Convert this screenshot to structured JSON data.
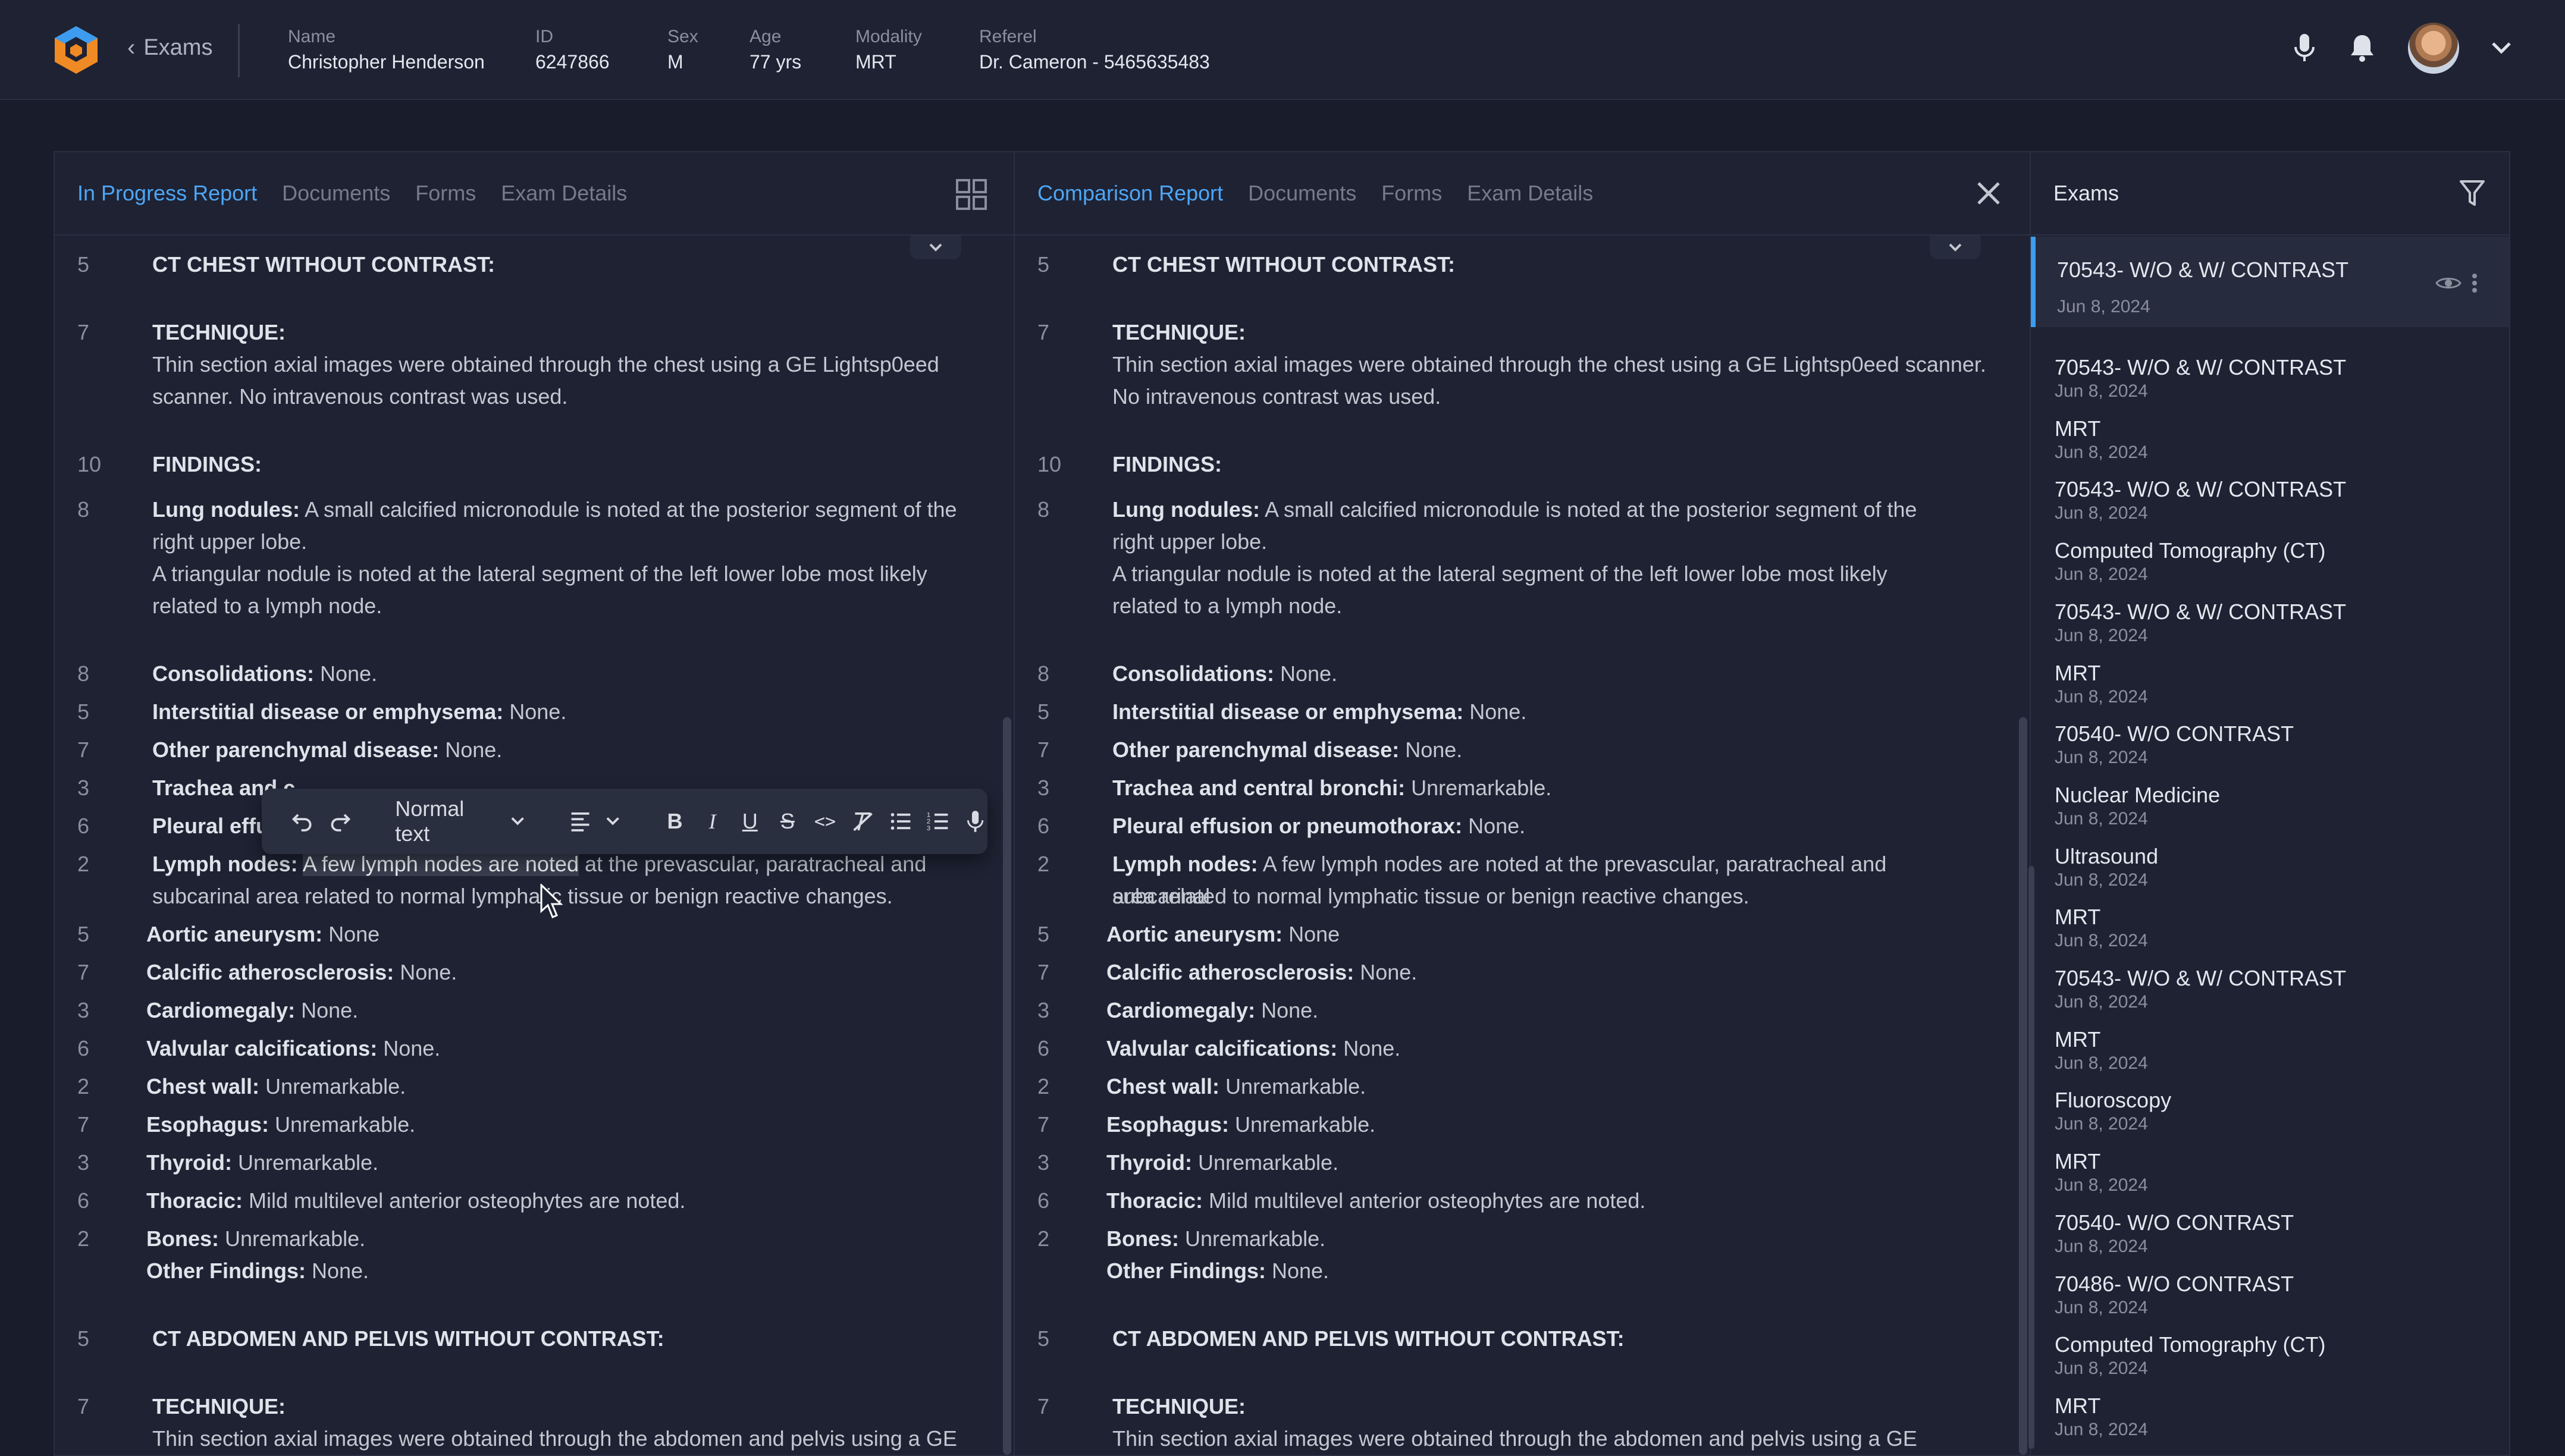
{
  "header": {
    "back_label": "Exams",
    "patient": [
      {
        "label": "Name",
        "value": "Christopher Henderson"
      },
      {
        "label": "ID",
        "value": "6247866"
      },
      {
        "label": "Sex",
        "value": "M"
      },
      {
        "label": "Age",
        "value": "77 yrs"
      },
      {
        "label": "Modality",
        "value": "MRT"
      },
      {
        "label": "Referel",
        "value": "Dr. Cameron - 5465635483"
      }
    ]
  },
  "left_panel": {
    "tabs": [
      "In Progress Report",
      "Documents",
      "Forms",
      "Exam Details"
    ]
  },
  "compare_panel": {
    "tabs": [
      "Comparison Report",
      "Documents",
      "Forms",
      "Exam Details"
    ]
  },
  "exams_panel": {
    "title": "Exams",
    "items": [
      {
        "name": "70543- W/O & W/ CONTRAST",
        "date": "Jun 8, 2024"
      },
      {
        "name": "70543- W/O & W/ CONTRAST",
        "date": "Jun 8, 2024"
      },
      {
        "name": "MRT",
        "date": "Jun 8, 2024"
      },
      {
        "name": "70543- W/O & W/ CONTRAST",
        "date": "Jun 8, 2024"
      },
      {
        "name": "Computed Tomography (CT)",
        "date": "Jun 8, 2024"
      },
      {
        "name": "70543- W/O & W/ CONTRAST",
        "date": "Jun 8, 2024"
      },
      {
        "name": "MRT",
        "date": "Jun 8, 2024"
      },
      {
        "name": "70540- W/O CONTRAST",
        "date": "Jun 8, 2024"
      },
      {
        "name": "Nuclear Medicine",
        "date": "Jun 8, 2024"
      },
      {
        "name": "Ultrasound",
        "date": "Jun 8, 2024"
      },
      {
        "name": "MRT",
        "date": "Jun 8, 2024"
      },
      {
        "name": "70543- W/O & W/ CONTRAST",
        "date": "Jun 8, 2024"
      },
      {
        "name": "MRT",
        "date": "Jun 8, 2024"
      },
      {
        "name": "Fluoroscopy",
        "date": "Jun 8, 2024"
      },
      {
        "name": "MRT",
        "date": "Jun 8, 2024"
      },
      {
        "name": "70540- W/O CONTRAST",
        "date": "Jun 8, 2024"
      },
      {
        "name": "70486- W/O CONTRAST",
        "date": "Jun 8, 2024"
      },
      {
        "name": "Computed Tomography (CT)",
        "date": "Jun 8, 2024"
      },
      {
        "name": "MRT",
        "date": "Jun 8, 2024"
      }
    ]
  },
  "toolbar": {
    "style_label": "Normal text"
  },
  "left_report": [
    {
      "n": "5",
      "b": "CT CHEST WITHOUT CONTRAST:",
      "t": ""
    },
    {
      "n": "7",
      "b": "TECHNIQUE:",
      "t": ""
    },
    {
      "n": "",
      "b": "",
      "t": "Thin section axial images were obtained through the chest using a GE Lightsp0eed"
    },
    {
      "n": "",
      "b": "",
      "t": "scanner. No intravenous contrast was used."
    },
    {
      "n": "10",
      "b": "FINDINGS:",
      "t": ""
    },
    {
      "n": "8",
      "b": "Lung nodules:",
      "t": " A small calcified micronodule is noted at the posterior segment of the"
    },
    {
      "n": "",
      "b": "",
      "t": "right upper lobe."
    },
    {
      "n": "",
      "b": "",
      "t": "A triangular nodule is noted at the lateral segment of the left lower lobe most likely"
    },
    {
      "n": "",
      "b": "",
      "t": "related to a lymph node."
    },
    {
      "n": "8",
      "b": "Consolidations:",
      "t": " None."
    },
    {
      "n": "5",
      "b": "Interstitial disease or emphysema:",
      "t": " None."
    },
    {
      "n": "7",
      "b": "Other parenchymal disease:",
      "t": " None."
    },
    {
      "n": "3",
      "b": "Trachea and c",
      "t": ""
    },
    {
      "n": "6",
      "b": "Pleural effusio",
      "t": ""
    },
    {
      "n": "2",
      "b": "Lymph nodes:",
      "h": "A few lymph nodes are noted",
      "t": " at the prevascular, paratracheal and"
    },
    {
      "n": "",
      "b": "",
      "t": "subcarinal area related to normal lymphatic tissue or benign reactive changes."
    },
    {
      "n": "5",
      "b": "Aortic aneurysm:",
      "t": " None"
    },
    {
      "n": "7",
      "b": "Calcific atherosclerosis:",
      "t": " None."
    },
    {
      "n": "3",
      "b": "Cardiomegaly:",
      "t": " None."
    },
    {
      "n": "6",
      "b": "Valvular calcifications:",
      "t": " None."
    },
    {
      "n": "2",
      "b": "Chest wall:",
      "t": " Unremarkable."
    },
    {
      "n": "7",
      "b": "Esophagus:",
      "t": " Unremarkable."
    },
    {
      "n": "3",
      "b": "Thyroid:",
      "t": " Unremarkable."
    },
    {
      "n": "6",
      "b": "Thoracic:",
      "t": " Mild multilevel anterior osteophytes are noted."
    },
    {
      "n": "2",
      "b": "Bones:",
      "t": " Unremarkable."
    },
    {
      "n": "",
      "b": "Other Findings:",
      "t": " None."
    },
    {
      "n": "5",
      "b": "CT ABDOMEN AND PELVIS WITHOUT CONTRAST:",
      "t": ""
    },
    {
      "n": "7",
      "b": "TECHNIQUE:",
      "t": ""
    },
    {
      "n": "",
      "b": "",
      "t": "Thin section axial images were obtained through the abdomen and pelvis using a GE"
    }
  ],
  "right_report": [
    {
      "n": "5",
      "b": "CT CHEST WITHOUT CONTRAST:",
      "t": ""
    },
    {
      "n": "7",
      "b": "TECHNIQUE:",
      "t": ""
    },
    {
      "n": "",
      "b": "",
      "t": "Thin section axial images were obtained through the chest using a GE Lightsp0eed scanner."
    },
    {
      "n": "",
      "b": "",
      "t": "No intravenous contrast was used."
    },
    {
      "n": "10",
      "b": "FINDINGS:",
      "t": ""
    },
    {
      "n": "8",
      "b": "Lung nodules:",
      "t": " A small calcified micronodule is noted at the posterior segment of the"
    },
    {
      "n": "",
      "b": "",
      "t": "right upper lobe."
    },
    {
      "n": "",
      "b": "",
      "t": "A triangular nodule is noted at the lateral segment of the left lower lobe most likely"
    },
    {
      "n": "",
      "b": "",
      "t": "related to a lymph node."
    },
    {
      "n": "8",
      "b": "Consolidations:",
      "t": " None."
    },
    {
      "n": "5",
      "b": "Interstitial disease or emphysema:",
      "t": " None."
    },
    {
      "n": "7",
      "b": "Other parenchymal disease:",
      "t": " None."
    },
    {
      "n": "3",
      "b": "Trachea and central bronchi:",
      "t": " Unremarkable."
    },
    {
      "n": "6",
      "b": "Pleural effusion or pneumothorax:",
      "t": " None."
    },
    {
      "n": "2",
      "b": "Lymph nodes:",
      "t": " A few lymph nodes are noted at the prevascular, paratracheal and subcarinal"
    },
    {
      "n": "",
      "b": "",
      "t": "area related to normal lymphatic tissue or benign reactive changes."
    },
    {
      "n": "5",
      "b": "Aortic aneurysm:",
      "t": " None"
    },
    {
      "n": "7",
      "b": "Calcific atherosclerosis:",
      "t": " None."
    },
    {
      "n": "3",
      "b": "Cardiomegaly:",
      "t": " None."
    },
    {
      "n": "6",
      "b": "Valvular calcifications:",
      "t": " None."
    },
    {
      "n": "2",
      "b": "Chest wall:",
      "t": " Unremarkable."
    },
    {
      "n": "7",
      "b": "Esophagus:",
      "t": " Unremarkable."
    },
    {
      "n": "3",
      "b": "Thyroid:",
      "t": " Unremarkable."
    },
    {
      "n": "6",
      "b": "Thoracic:",
      "t": " Mild multilevel anterior osteophytes are noted."
    },
    {
      "n": "2",
      "b": "Bones:",
      "t": " Unremarkable."
    },
    {
      "n": "",
      "b": "Other Findings:",
      "t": " None."
    },
    {
      "n": "5",
      "b": "CT ABDOMEN AND PELVIS WITHOUT CONTRAST:",
      "t": ""
    },
    {
      "n": "7",
      "b": "TECHNIQUE:",
      "t": ""
    },
    {
      "n": "",
      "b": "",
      "t": "Thin section axial images were obtained through the abdomen and pelvis using a GE"
    }
  ]
}
